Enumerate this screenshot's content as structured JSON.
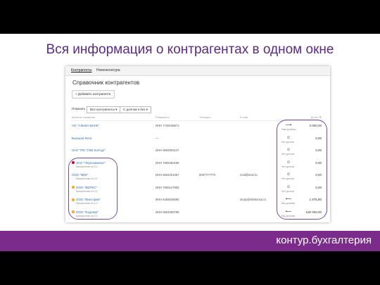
{
  "slide": {
    "title": "Вся информация о контрагентах в одном окне",
    "brand": "контур.бухгалтерия",
    "colors": {
      "accent": "#5b2a86",
      "footer": "#7b2c8b"
    }
  },
  "app": {
    "tabs": [
      "Контрагенты",
      "Номенклатура"
    ],
    "heading": "Справочник контрагентов",
    "add_button": "Добавить контрагента",
    "filter": {
      "label": "Показать",
      "scope": "Все контрагенты",
      "debt": "С долгом и без"
    },
    "columns": {
      "name": "Краткое название",
      "requisites": "Реквизиты",
      "phone": "Телефон",
      "email": "E-mail",
      "debt": "Долги"
    },
    "rows": [
      {
        "name": "АО \"АЛЬФА-БАНК\"",
        "sub": "",
        "inn": "ИНН 7728168971",
        "phone": "",
        "email": "",
        "debt_label": "Нам должны",
        "amount": "3 000,00",
        "status_color": ""
      },
      {
        "name": "Бывшая Яхта",
        "sub": "",
        "inn": "—",
        "phone": "",
        "email": "",
        "debt_label": "Нет долгов",
        "amount": "0,00",
        "status_color": ""
      },
      {
        "name": "ЗАО \"ПФ \"СКБ Контур\"",
        "sub": "",
        "inn": "ИНН 6663003127",
        "phone": "",
        "email": "",
        "debt_label": "Нет долгов",
        "amount": "0,00",
        "status_color": ""
      },
      {
        "name": "ЗАО \"Черноземное\"",
        "sub": "Банкротство по СС",
        "inn": "ИНН 7806460158",
        "phone": "",
        "email": "",
        "debt_label": "Нет долгов",
        "amount": "0,00",
        "status_color": "#d0021b"
      },
      {
        "name": "ООО \"ВКК\"",
        "sub": "Банкротство по СС",
        "inn": "ИНН 6661001067",
        "phone": "8007777770",
        "email": "mail@mail.ru",
        "debt_label": "Нет долгов",
        "amount": "0,00",
        "status_color": ""
      },
      {
        "name": "ООО \"ВЕРЕС\"",
        "sub": "Банкротство по СС",
        "inn": "ИНН 7806147983",
        "phone": "",
        "email": "",
        "debt_label": "Нет долгов",
        "amount": "0,00",
        "status_color": "#f5a623"
      },
      {
        "name": "ООО \"Винторин\"",
        "sub": "Банкротство по СС",
        "inn": "ИНН 6459046080",
        "phone": "",
        "email": "study@skbkontur.ru",
        "debt_label": "Мы должны",
        "amount": "1 875,80",
        "status_color": "#f5a623"
      },
      {
        "name": "ООО \"Ездовка\"",
        "sub": "Банкротство по СС",
        "inn": "ИНН 5604059798",
        "phone": "",
        "email": "",
        "debt_label": "Мы должны",
        "amount": "100 000,00",
        "status_color": "#f5a623"
      }
    ],
    "debt_icons": [
      "arrow-right-icon",
      "smile-icon",
      "smile-icon",
      "smile-icon",
      "smile-icon",
      "smile-icon",
      "arrow-left-icon",
      "arrow-left-icon"
    ]
  }
}
